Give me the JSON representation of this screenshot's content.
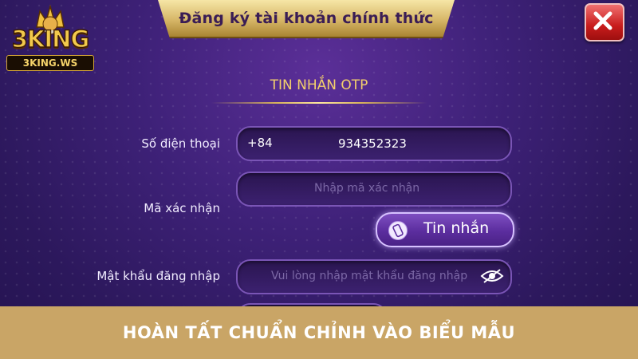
{
  "brand": {
    "logo_text": "3KING",
    "logo_domain": "3KING.WS"
  },
  "dialog": {
    "title": "Đăng ký tài khoản chính thức"
  },
  "section": {
    "title": "TIN NHẮN OTP"
  },
  "form": {
    "phone": {
      "label": "Số điện thoại",
      "prefix": "+84",
      "value": "934352323"
    },
    "code": {
      "label": "Mã xác nhận",
      "placeholder": "Nhập mã xác nhận"
    },
    "sms_button": {
      "label": "Tin nhắn"
    },
    "password": {
      "label": "Mật khẩu đăng nhập",
      "placeholder": "Vui lòng nhập mật khẩu đăng nhập"
    }
  },
  "banner": {
    "text": "HOÀN TẤT CHUẨN CHỈNH VÀO BIỂU MẪU"
  },
  "icons": {
    "close": "close-icon",
    "phone": "phone-icon",
    "eye": "eye-slash-icon",
    "logo": "crowned-king-logo"
  },
  "colors": {
    "background": "#3e2178",
    "gold": "#f3cf6c",
    "close_red": "#c81c1c",
    "banner": "#c9a566"
  }
}
